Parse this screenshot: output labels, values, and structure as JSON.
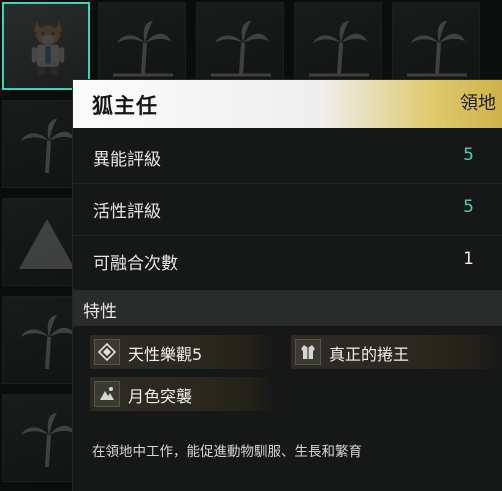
{
  "pal": {
    "name": "狐主任",
    "work_type": "領地"
  },
  "stats": [
    {
      "label": "異能評級",
      "value": "5",
      "color": "#46d3b8"
    },
    {
      "label": "活性評級",
      "value": "5",
      "color": "#46d3b8"
    },
    {
      "label": "可融合次數",
      "value": "1",
      "color": "#ececec"
    }
  ],
  "traits": {
    "title": "特性",
    "items": [
      {
        "label": "天性樂觀5",
        "icon": "diamond-icon"
      },
      {
        "label": "真正的捲王",
        "icon": "coat-icon"
      },
      {
        "label": "月色突襲",
        "icon": "mountain-icon"
      }
    ]
  },
  "description": "在領地中工作，能促進動物馴服、生長和繁育",
  "colors": {
    "accent": "#3fd2b4",
    "header_gold": "#cfb24a",
    "panel_bg": "#161717"
  }
}
